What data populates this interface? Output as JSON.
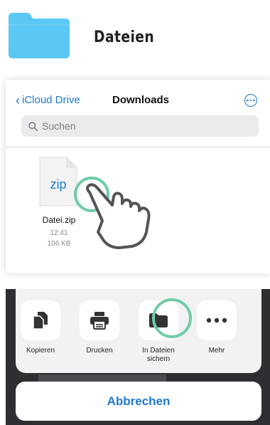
{
  "header": {
    "title": "Dateien",
    "folder_color": "#5ac8f5"
  },
  "files": {
    "back_label": "iCloud Drive",
    "title": "Downloads",
    "search_placeholder": "Suchen",
    "file": {
      "type_label": "zip",
      "name": "Datei.zip",
      "time": "12:41",
      "size": "106 KB"
    },
    "accent_color": "#1f78d1"
  },
  "share_sheet": {
    "actions": [
      {
        "label": "Kopieren",
        "icon": "copy-icon"
      },
      {
        "label": "Drucken",
        "icon": "printer-icon"
      },
      {
        "label": "In Dateien sichern",
        "icon": "folder-icon"
      },
      {
        "label": "Mehr",
        "icon": "more-icon"
      }
    ],
    "cancel_label": "Abbrechen"
  },
  "highlight_color": "#6fcca7"
}
